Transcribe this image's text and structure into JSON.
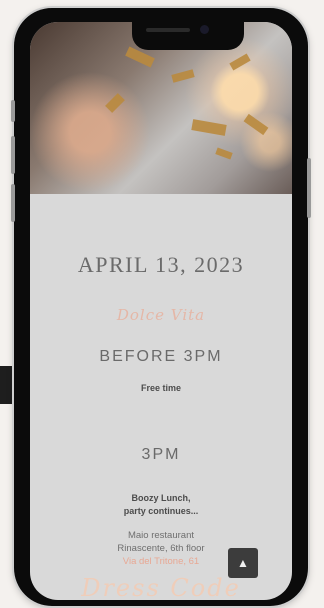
{
  "event": {
    "date": "APRIL 13, 2023",
    "brand_script": "Dolce Vita",
    "schedule": [
      {
        "time": "BEFORE 3PM",
        "lines": [
          "Free time"
        ]
      },
      {
        "time": "3PM",
        "lines": [
          "Boozy Lunch,",
          "party continues..."
        ]
      }
    ],
    "venue": {
      "name": "Maio restaurant",
      "floor": "Rinascente, 6th floor",
      "street": "Via del Tritone, 61"
    },
    "dress_code_script": "Dress Code"
  },
  "ui": {
    "scroll_top_icon": "chevron-up-icon",
    "scroll_top_glyph": "▲"
  },
  "colors": {
    "accent_script": "#e5b7a7",
    "link": "#e8a894",
    "text": "#6a6a6a"
  }
}
